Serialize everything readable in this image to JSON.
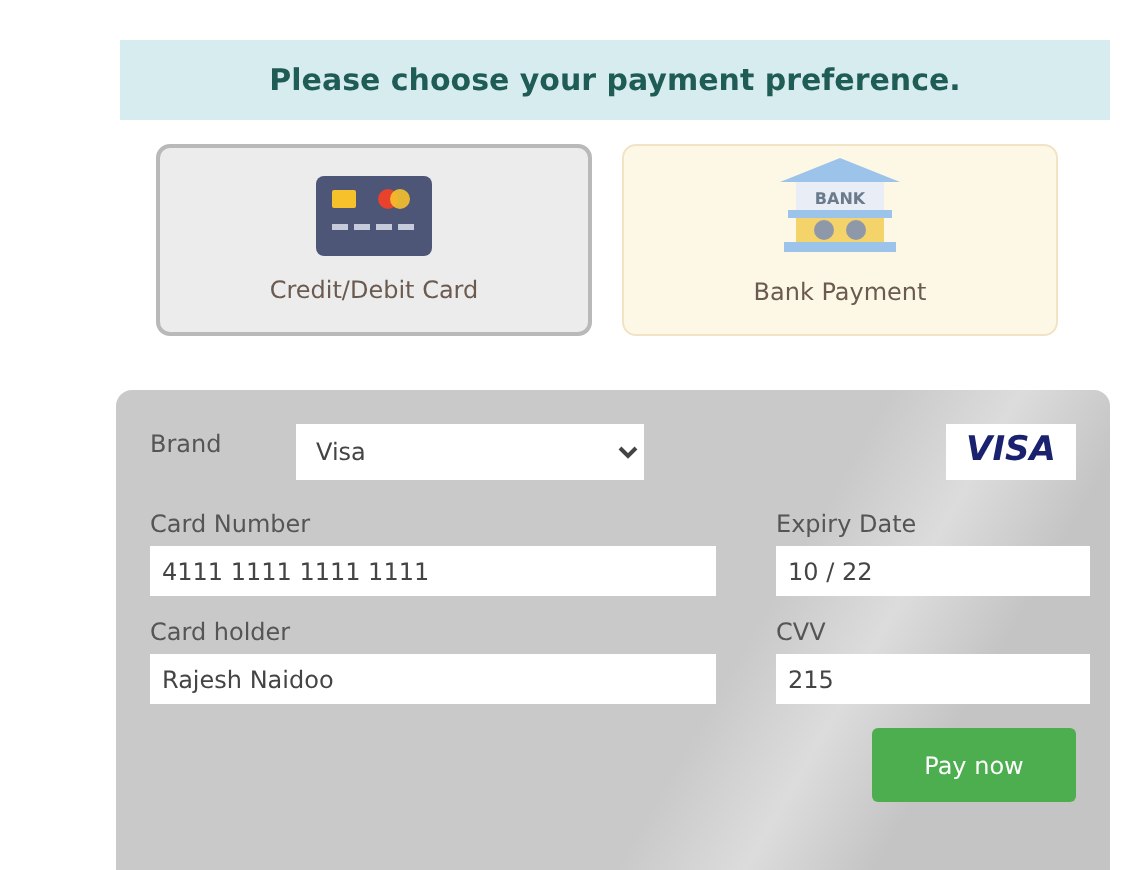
{
  "heading": "Please choose your payment preference.",
  "methods": [
    {
      "kind": "card",
      "label": "Credit/Debit Card",
      "selected": true
    },
    {
      "kind": "bank",
      "label": "Bank Payment",
      "icon_text": "BANK",
      "selected": false
    }
  ],
  "form": {
    "brand": {
      "label": "Brand",
      "value": "Visa",
      "logo": "VISA"
    },
    "fields": [
      {
        "label": "Card Number",
        "value": "4111 1111 1111 1111",
        "kind": "wide"
      },
      {
        "label": "Expiry Date",
        "value": "10 / 22",
        "kind": "narrow"
      },
      {
        "label": "Card holder",
        "value": "Rajesh Naidoo",
        "kind": "wide"
      },
      {
        "label": "CVV",
        "value": "215",
        "kind": "narrow"
      }
    ],
    "submit": "Pay now"
  }
}
